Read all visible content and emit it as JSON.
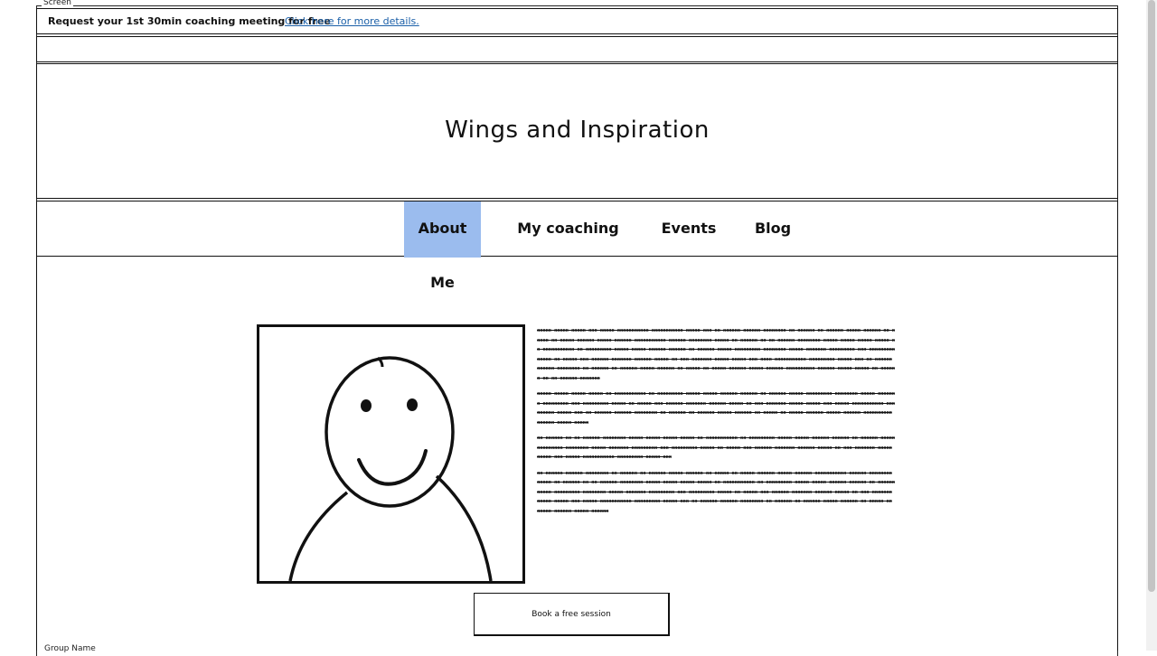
{
  "screen_label": "Screen",
  "promo": {
    "text": "Request your 1st 30min coaching meeting for free",
    "link": "Click here for more details."
  },
  "header": {
    "title": "Wings and Inspiration"
  },
  "nav": {
    "items": [
      {
        "label": "About Me",
        "active": true
      },
      {
        "label": "My coaching",
        "active": false
      },
      {
        "label": "Events",
        "active": false
      },
      {
        "label": "Blog",
        "active": false
      }
    ],
    "active_color": "#9bbcee"
  },
  "bio": {
    "paragraphs": [
      "xxxxx xxxxx xxxxx xxx xxxxx xxxxxxxxxxx xxxxxxxxxxx xxxxx xxx xx xxxxxx xxxxxx xxxxxxxx xx xxxxxx xx xxxxxx xxxxx xxxxxx xx xxxxx xx xxxxx xxxxxx xxxxx xxxxxx xxxxxxxxxxx xxxxxx xxxxxxxx xxxxx xx xxxxxx xx xx xxxxxx xxxxxxxx xxxxx xxxxx xxxxx xxxxx xx xxxxxxxxxxx xx xxxxxxxxx xxxxx xxxxx xxxxxx xxxxxx xx xxxxxx xxxxx xxxxxxxxx xxxxxxxx xxxxx xxxxxxx xxxxxxxxx xxx xxxxxxxxx xxxxx xx xxxxx xxx xxxxxx xxxxxxx xxxxxx xxxxx xx xxx xxxxxxx xxxxx xxxxx xxx xxxx xxxxxxxxxxx xxxxxxxxx xxxxx xxx xx xxxxxx xxxxxx xxxxxxxx xx xxxxxx xx xxxxxx xxxxx xxxxxx xx xxxxx xx xxxxx xxxxxx xxxxx xxxxxx xxxxxxxxxx xxxxxx xxxxx xxxxx xx xxxxxx xx xx xxxxxx xxxxxxx",
      "xxxxx xxxxx xxxxx xxxxx xx xxxxxxxxxxx xx xxxxxxxxx xxxxx xxxxx xxxxxx xxxxxx xx xxxxxx xxxxx xxxxxxxxx xxxxxxxx xxxxx xxxxxxx xxxxxxxxx xxx xxxxxxxxx xxxxx xx xxxxx xxx xxxxxx xxxxxxx xxxxxx xxxxx xx xxx xxxxxxx xxxxx xxxxx xxx xxxxx xxxxxxxxxxx xxxxxxxxx xxxxx xxx xx xxxxxx xxxxxx xxxxxxxx xx xxxxxx xx xxxxxx xxxxx xxxxxx xx xxxxx xx xxxxx xxxxxx xxxxx xxxxxx xxxxxxxxxx xxxxxx xxxxx xxxxx",
      "xx xxxxxx xx xx xxxxxx xxxxxxxx xxxxx xxxxx xxxxx xxxxx xx xxxxxxxxxxx xx xxxxxxxxx xxxxx xxxxx xxxxxx xxxxxx xx xxxxxx xxxxx xxxxxxxxx xxxxxxxx xxxxx xxxxxxx xxxxxxxxx xxx xxxxxxxxx xxxxx xx xxxxx xxx xxxxxx xxxxxxx xxxxxx xxxxx xx xxx xxxxxxx xxxxx xxxxx xxx xxxxx xxxxxxxxxxx xxxxxxxxx xxxxx xxx",
      "xx xxxxxx xxxxxx xxxxxxxx xx xxxxxx xx xxxxxx xxxxx xxxxxx xx xxxxx xx xxxxx xxxxxx xxxxx xxxxxx xxxxxxxxxxx xxxxxx xxxxxxxx xxxxx xx xxxxxx xx xx xxxxxx xxxxxxxx xxxxx xxxxx xxxxx xxxxx xx xxxxxxxxxxx xx xxxxxxxxx xxxxx xxxxx xxxxxx xxxxxx xx xxxxxx xxxxx xxxxxxxxx xxxxxxxx xxxxx xxxxxxx xxxxxxxxx xxx xxxxxxxxx xxxxx xx xxxxx xxx xxxxxx xxxxxxx xxxxxx xxxxx xx xxx xxxxxxx xxxxx xxxxx xxx xxxxx xxxxxxxxxxx xxxxxxxxx xxxxx xxx xx xxxxxx xxxxxx xxxxxxxx xx xxxxxx xx xxxxxx xxxxx xxxxxx xx xxxxx xx xxxxx xxxxxx xxxxx xxxxxx"
    ]
  },
  "cta": {
    "label": "Book a free session"
  },
  "group_label": "Group Name"
}
